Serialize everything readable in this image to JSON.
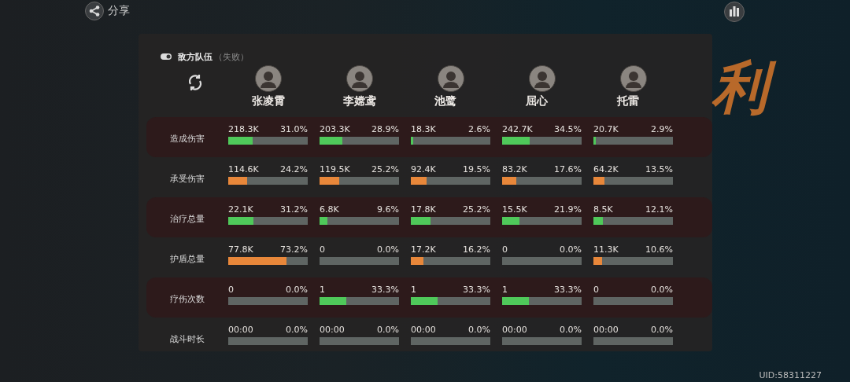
{
  "share": {
    "label": "分享"
  },
  "background_title": "利",
  "panel": {
    "team": "敌方队伍",
    "result": "（失败）",
    "players": [
      {
        "name": "张凌霄"
      },
      {
        "name": "李嫦鸢"
      },
      {
        "name": "池鹭"
      },
      {
        "name": "屈心"
      },
      {
        "name": "托雷"
      }
    ],
    "stats": [
      {
        "label": "造成伤害",
        "color": "#4fc95a",
        "cells": [
          {
            "value": "218.3K",
            "percent": "31.0%",
            "level": 0.31
          },
          {
            "value": "203.3K",
            "percent": "28.9%",
            "level": 0.289
          },
          {
            "value": "18.3K",
            "percent": "2.6%",
            "level": 0.026
          },
          {
            "value": "242.7K",
            "percent": "34.5%",
            "level": 0.345
          },
          {
            "value": "20.7K",
            "percent": "2.9%",
            "level": 0.029
          }
        ]
      },
      {
        "label": "承受伤害",
        "color": "#e8873a",
        "cells": [
          {
            "value": "114.6K",
            "percent": "24.2%",
            "level": 0.242
          },
          {
            "value": "119.5K",
            "percent": "25.2%",
            "level": 0.252
          },
          {
            "value": "92.4K",
            "percent": "19.5%",
            "level": 0.195
          },
          {
            "value": "83.2K",
            "percent": "17.6%",
            "level": 0.176
          },
          {
            "value": "64.2K",
            "percent": "13.5%",
            "level": 0.135
          }
        ]
      },
      {
        "label": "治疗总量",
        "color": "#4fc95a",
        "cells": [
          {
            "value": "22.1K",
            "percent": "31.2%",
            "level": 0.312
          },
          {
            "value": "6.8K",
            "percent": "9.6%",
            "level": 0.096
          },
          {
            "value": "17.8K",
            "percent": "25.2%",
            "level": 0.252
          },
          {
            "value": "15.5K",
            "percent": "21.9%",
            "level": 0.219
          },
          {
            "value": "8.5K",
            "percent": "12.1%",
            "level": 0.121
          }
        ]
      },
      {
        "label": "护盾总量",
        "color": "#e8873a",
        "cells": [
          {
            "value": "77.8K",
            "percent": "73.2%",
            "level": 0.732
          },
          {
            "value": "0",
            "percent": "0.0%",
            "level": 0
          },
          {
            "value": "17.2K",
            "percent": "16.2%",
            "level": 0.162
          },
          {
            "value": "0",
            "percent": "0.0%",
            "level": 0
          },
          {
            "value": "11.3K",
            "percent": "10.6%",
            "level": 0.106
          }
        ]
      },
      {
        "label": "疗伤次数",
        "color": "#4fc95a",
        "cells": [
          {
            "value": "0",
            "percent": "0.0%",
            "level": 0
          },
          {
            "value": "1",
            "percent": "33.3%",
            "level": 0.333
          },
          {
            "value": "1",
            "percent": "33.3%",
            "level": 0.333
          },
          {
            "value": "1",
            "percent": "33.3%",
            "level": 0.333
          },
          {
            "value": "0",
            "percent": "0.0%",
            "level": 0
          }
        ]
      },
      {
        "label": "战斗时长",
        "cells": [
          {
            "value": "00:00",
            "percent": "0.0%",
            "level": 0
          },
          {
            "value": "00:00",
            "percent": "0.0%",
            "level": 0
          },
          {
            "value": "00:00",
            "percent": "0.0%",
            "level": 0
          },
          {
            "value": "00:00",
            "percent": "0.0%",
            "level": 0
          },
          {
            "value": "00:00",
            "percent": "0.0%",
            "level": 0
          }
        ]
      }
    ]
  },
  "uid": "UID:58311227"
}
